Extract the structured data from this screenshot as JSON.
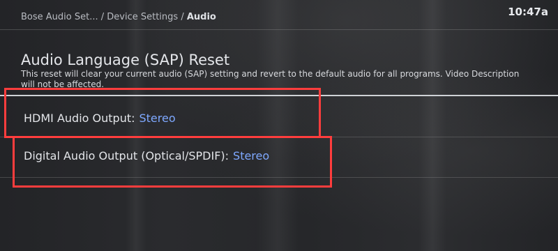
{
  "breadcrumb": {
    "part1": "Bose Audio Set...",
    "sep1": " / ",
    "part2": "Device Settings",
    "sep2": " / ",
    "current": "Audio"
  },
  "clock": "10:47a",
  "sap": {
    "title": "Audio Language (SAP) Reset",
    "description": "This reset will clear your current audio (SAP) setting and revert to the default audio for all programs. Video Description will not be affected."
  },
  "menu": {
    "hdmi": {
      "label": "HDMI Audio Output:",
      "value": "Stereo"
    },
    "digital": {
      "label": "Digital Audio Output (Optical/SPDIF):",
      "value": "Stereo"
    }
  },
  "colors": {
    "value_text": "#7ea8ff",
    "highlight_box": "#ff3d3d"
  }
}
